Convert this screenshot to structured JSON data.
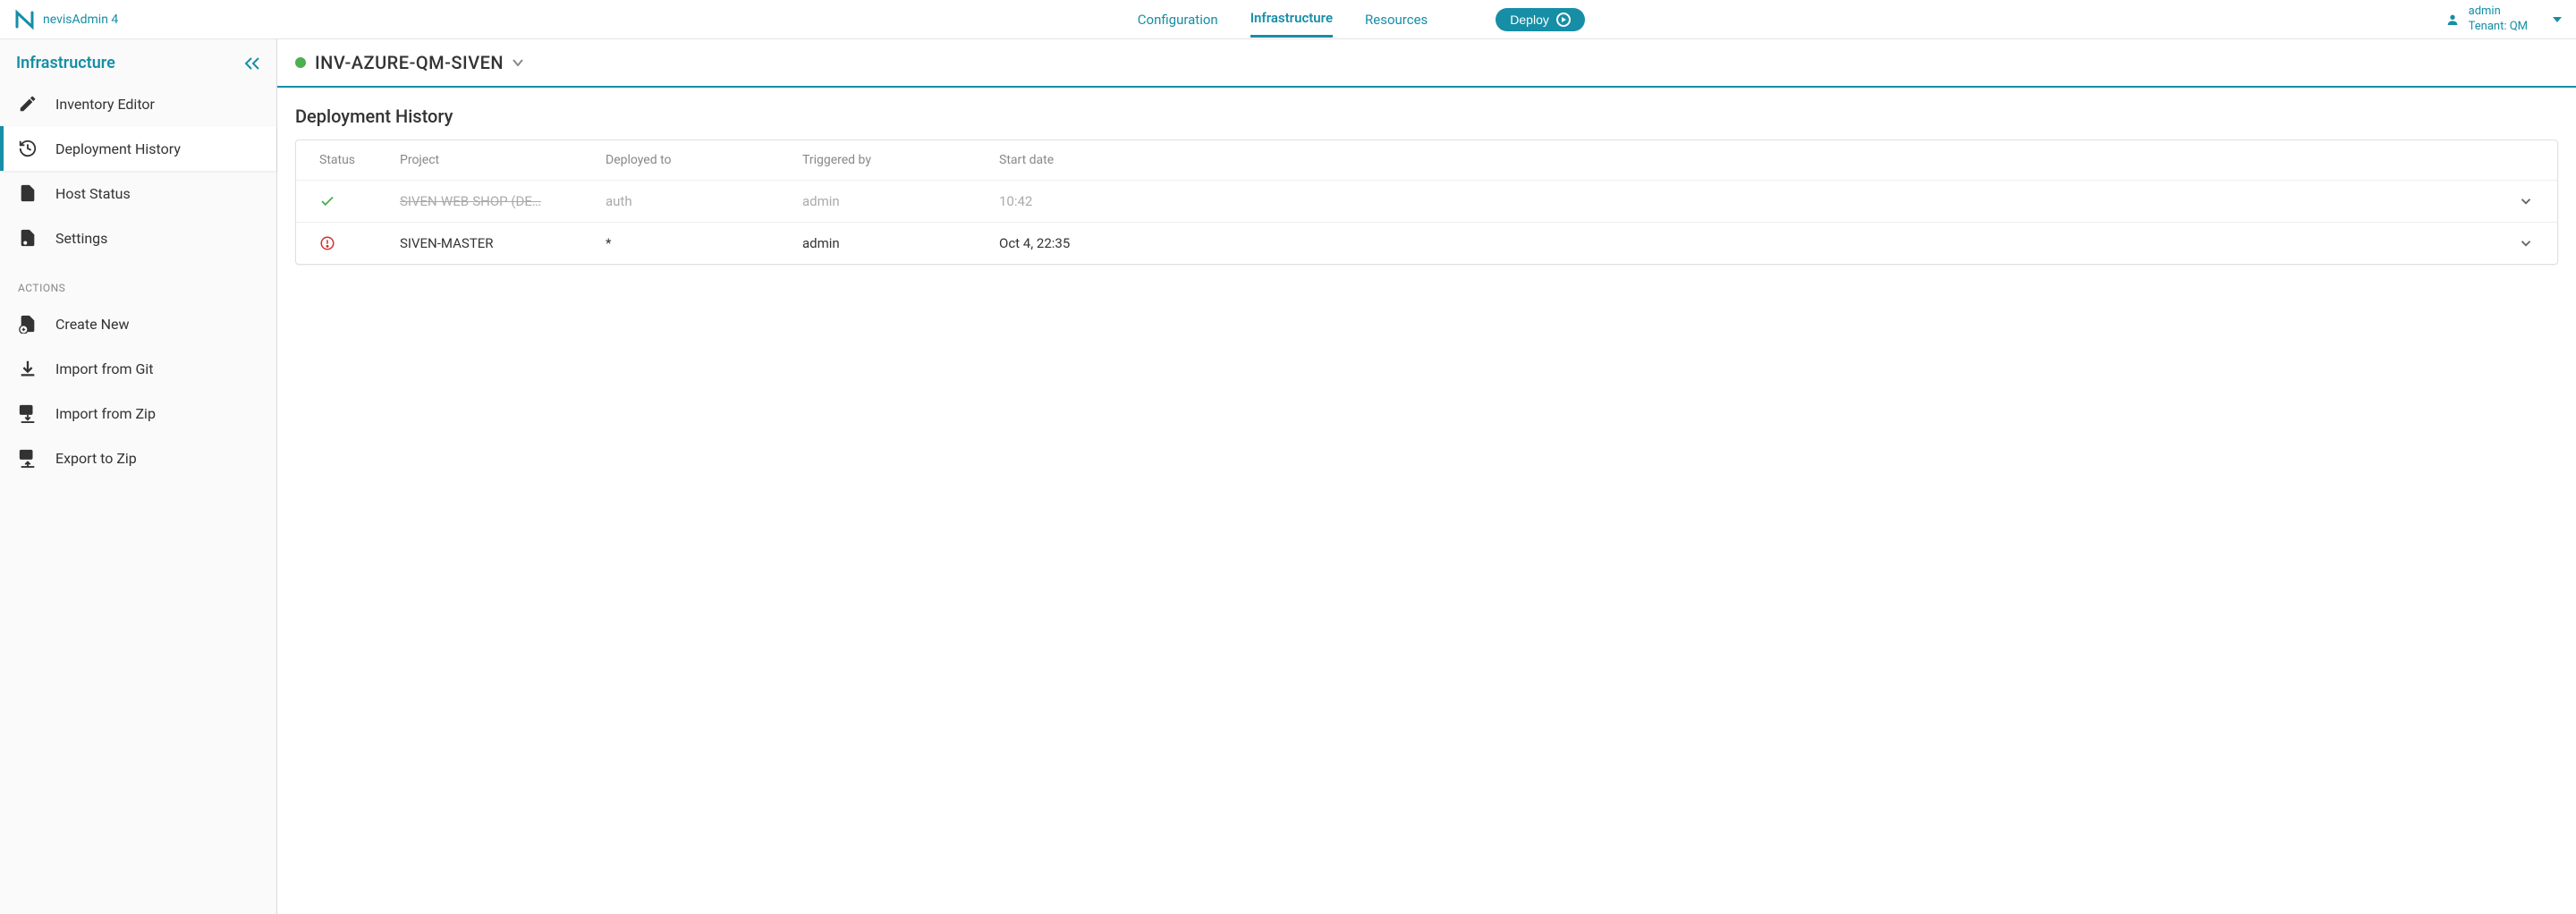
{
  "app_name": "nevisAdmin 4",
  "top_nav": {
    "configuration": "Configuration",
    "infrastructure": "Infrastructure",
    "resources": "Resources",
    "deploy": "Deploy"
  },
  "user": {
    "name": "admin",
    "tenant_line": "Tenant: QM"
  },
  "sidebar": {
    "title": "Infrastructure",
    "items": {
      "inventory_editor": "Inventory Editor",
      "deployment_history": "Deployment History",
      "host_status": "Host Status",
      "settings": "Settings"
    },
    "actions_label": "ACTIONS",
    "actions": {
      "create_new": "Create New",
      "import_git": "Import from Git",
      "import_zip": "Import from Zip",
      "export_zip": "Export to Zip"
    }
  },
  "inventory": {
    "name": "INV-AZURE-QM-SIVEN"
  },
  "page_title": "Deployment History",
  "table": {
    "headers": {
      "status": "Status",
      "project": "Project",
      "deployed_to": "Deployed to",
      "triggered_by": "Triggered by",
      "start_date": "Start date"
    },
    "rows": [
      {
        "status": "success",
        "project": "SIVEN-WEB-SHOP (DE…",
        "deployed_to": "auth",
        "triggered_by": "admin",
        "start_date": "10:42",
        "deleted": true
      },
      {
        "status": "error",
        "project": "SIVEN-MASTER",
        "deployed_to": "*",
        "triggered_by": "admin",
        "start_date": "Oct 4, 22:35",
        "deleted": false
      }
    ]
  }
}
